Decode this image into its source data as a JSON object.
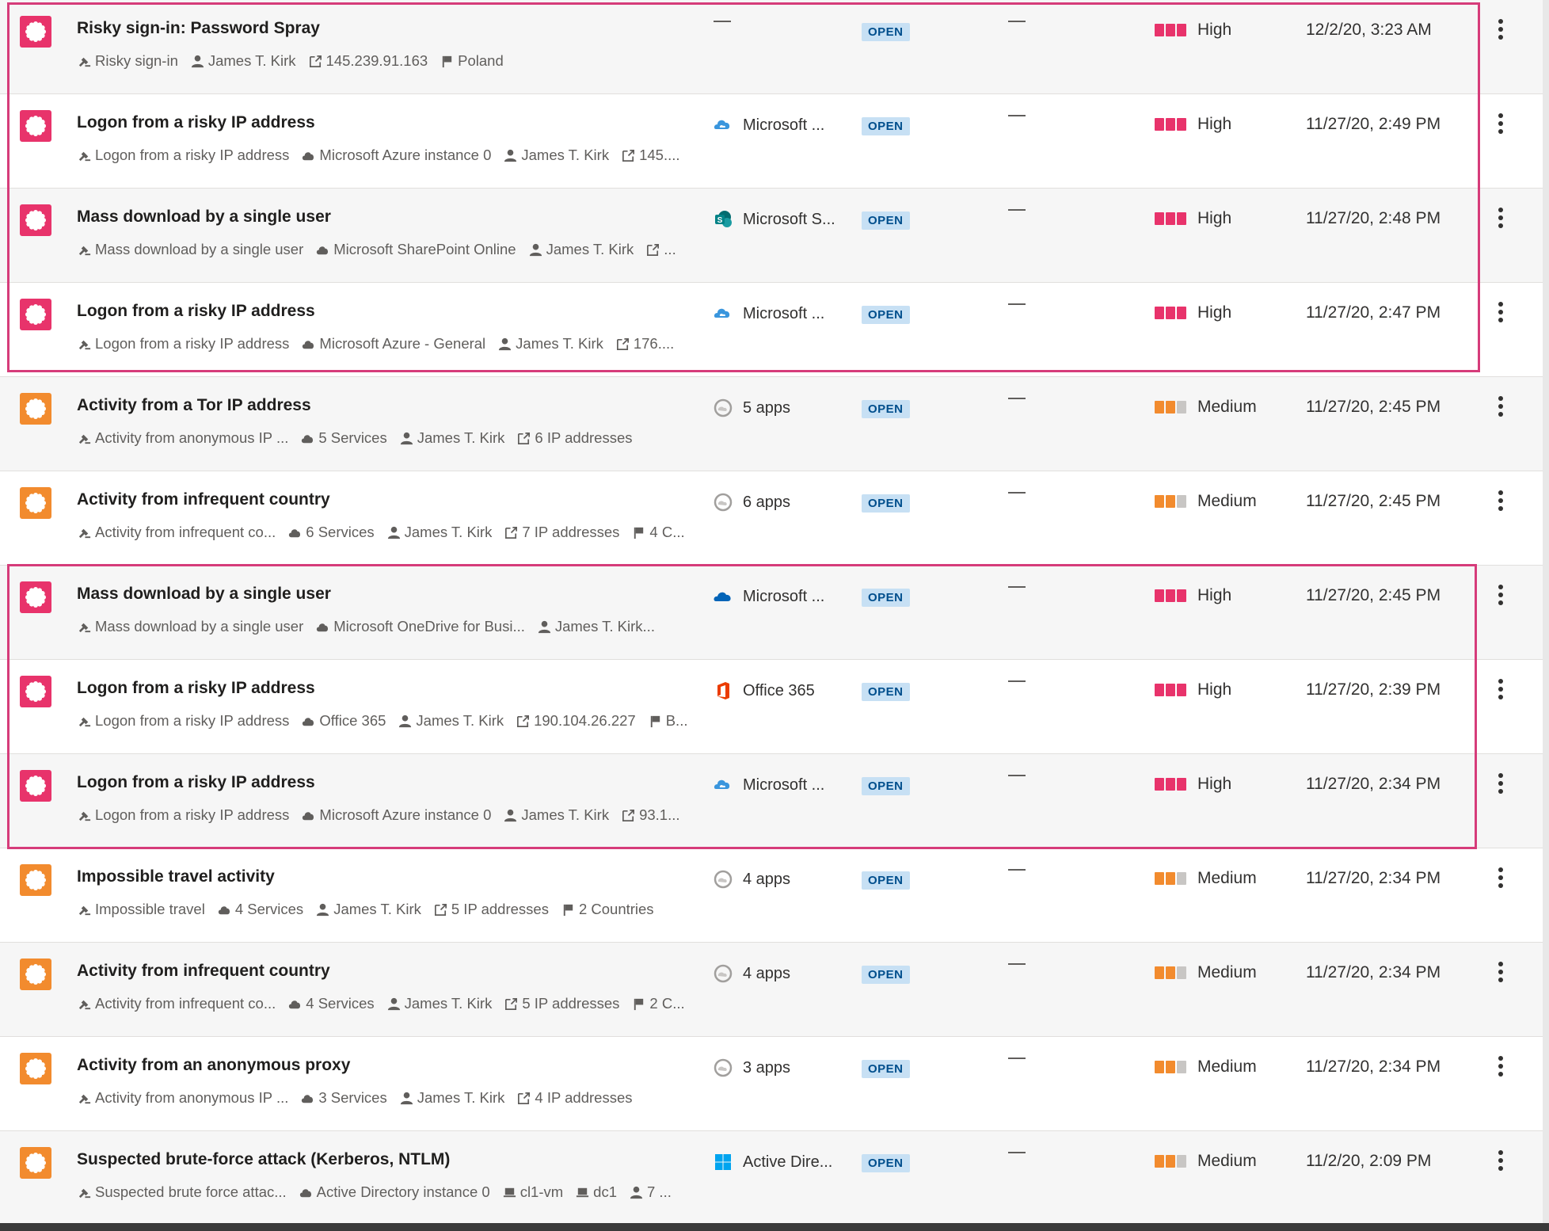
{
  "colors": {
    "high": "#e8336b",
    "medium": "#f28b2e",
    "open_badge_bg": "#c7e0f4",
    "highlight_border": "#d63c7a"
  },
  "alerts": [
    {
      "title": "Risky sign-in: Password Spray",
      "severity_class": "high",
      "meta": [
        {
          "icon": "policy-icon",
          "text": "Risky sign-in"
        },
        {
          "icon": "user-icon",
          "text": "James T. Kirk"
        },
        {
          "icon": "ip-icon",
          "text": "145.239.91.163"
        },
        {
          "icon": "flag-icon",
          "text": "Poland"
        }
      ],
      "app_icon": "none",
      "app": "",
      "status": "OPEN",
      "assigned": "—",
      "severity": "High",
      "time": "12/2/20, 3:23 AM"
    },
    {
      "title": "Logon from a risky IP address",
      "severity_class": "high",
      "meta": [
        {
          "icon": "policy-icon",
          "text": "Logon from a risky IP address"
        },
        {
          "icon": "cloud-icon",
          "text": "Microsoft Azure instance 0"
        },
        {
          "icon": "user-icon",
          "text": "James T. Kirk"
        },
        {
          "icon": "ip-icon",
          "text": "145...."
        }
      ],
      "app_icon": "azure-icon",
      "app": "Microsoft ...",
      "status": "OPEN",
      "assigned": "—",
      "severity": "High",
      "time": "11/27/20, 2:49 PM"
    },
    {
      "title": "Mass download by a single user",
      "severity_class": "high",
      "meta": [
        {
          "icon": "policy-icon",
          "text": "Mass download by a single user"
        },
        {
          "icon": "cloud-icon",
          "text": "Microsoft SharePoint Online"
        },
        {
          "icon": "user-icon",
          "text": "James T. Kirk"
        },
        {
          "icon": "ip-icon",
          "text": "..."
        }
      ],
      "app_icon": "sharepoint-icon",
      "app": "Microsoft S...",
      "status": "OPEN",
      "assigned": "—",
      "severity": "High",
      "time": "11/27/20, 2:48 PM"
    },
    {
      "title": "Logon from a risky IP address",
      "severity_class": "high",
      "meta": [
        {
          "icon": "policy-icon",
          "text": "Logon from a risky IP address"
        },
        {
          "icon": "cloud-icon",
          "text": "Microsoft Azure - General"
        },
        {
          "icon": "user-icon",
          "text": "James T. Kirk"
        },
        {
          "icon": "ip-icon",
          "text": "176...."
        }
      ],
      "app_icon": "azure-icon",
      "app": "Microsoft ...",
      "status": "OPEN",
      "assigned": "—",
      "severity": "High",
      "time": "11/27/20, 2:47 PM"
    },
    {
      "title": "Activity from a Tor IP address",
      "severity_class": "medium",
      "meta": [
        {
          "icon": "policy-icon",
          "text": "Activity from anonymous IP ..."
        },
        {
          "icon": "cloud-icon",
          "text": "5 Services"
        },
        {
          "icon": "user-icon",
          "text": "James T. Kirk"
        },
        {
          "icon": "ip-icon",
          "text": "6 IP addresses"
        }
      ],
      "app_icon": "apps-icon",
      "app": "5 apps",
      "status": "OPEN",
      "assigned": "—",
      "severity": "Medium",
      "time": "11/27/20, 2:45 PM"
    },
    {
      "title": "Activity from infrequent country",
      "severity_class": "medium",
      "meta": [
        {
          "icon": "policy-icon",
          "text": "Activity from infrequent co..."
        },
        {
          "icon": "cloud-icon",
          "text": "6 Services"
        },
        {
          "icon": "user-icon",
          "text": "James T. Kirk"
        },
        {
          "icon": "ip-icon",
          "text": "7 IP addresses"
        },
        {
          "icon": "flag-icon",
          "text": "4 C..."
        }
      ],
      "app_icon": "apps-icon",
      "app": "6 apps",
      "status": "OPEN",
      "assigned": "—",
      "severity": "Medium",
      "time": "11/27/20, 2:45 PM"
    },
    {
      "title": "Mass download by a single user",
      "severity_class": "high",
      "meta": [
        {
          "icon": "policy-icon",
          "text": "Mass download by a single user"
        },
        {
          "icon": "cloud-icon",
          "text": "Microsoft OneDrive for Busi..."
        },
        {
          "icon": "user-icon",
          "text": "James T. Kirk..."
        }
      ],
      "app_icon": "onedrive-icon",
      "app": "Microsoft ...",
      "status": "OPEN",
      "assigned": "—",
      "severity": "High",
      "time": "11/27/20, 2:45 PM"
    },
    {
      "title": "Logon from a risky IP address",
      "severity_class": "high",
      "meta": [
        {
          "icon": "policy-icon",
          "text": "Logon from a risky IP address"
        },
        {
          "icon": "cloud-icon",
          "text": "Office 365"
        },
        {
          "icon": "user-icon",
          "text": "James T. Kirk"
        },
        {
          "icon": "ip-icon",
          "text": "190.104.26.227"
        },
        {
          "icon": "flag-icon",
          "text": "B..."
        }
      ],
      "app_icon": "office365-icon",
      "app": "Office 365",
      "status": "OPEN",
      "assigned": "—",
      "severity": "High",
      "time": "11/27/20, 2:39 PM"
    },
    {
      "title": "Logon from a risky IP address",
      "severity_class": "high",
      "meta": [
        {
          "icon": "policy-icon",
          "text": "Logon from a risky IP address"
        },
        {
          "icon": "cloud-icon",
          "text": "Microsoft Azure instance 0"
        },
        {
          "icon": "user-icon",
          "text": "James T. Kirk"
        },
        {
          "icon": "ip-icon",
          "text": "93.1..."
        }
      ],
      "app_icon": "azure-icon",
      "app": "Microsoft ...",
      "status": "OPEN",
      "assigned": "—",
      "severity": "High",
      "time": "11/27/20, 2:34 PM"
    },
    {
      "title": "Impossible travel activity",
      "severity_class": "medium",
      "meta": [
        {
          "icon": "policy-icon",
          "text": "Impossible travel"
        },
        {
          "icon": "cloud-icon",
          "text": "4 Services"
        },
        {
          "icon": "user-icon",
          "text": "James T. Kirk"
        },
        {
          "icon": "ip-icon",
          "text": "5 IP addresses"
        },
        {
          "icon": "flag-icon",
          "text": "2 Countries"
        }
      ],
      "app_icon": "apps-icon",
      "app": "4 apps",
      "status": "OPEN",
      "assigned": "—",
      "severity": "Medium",
      "time": "11/27/20, 2:34 PM"
    },
    {
      "title": "Activity from infrequent country",
      "severity_class": "medium",
      "meta": [
        {
          "icon": "policy-icon",
          "text": "Activity from infrequent co..."
        },
        {
          "icon": "cloud-icon",
          "text": "4 Services"
        },
        {
          "icon": "user-icon",
          "text": "James T. Kirk"
        },
        {
          "icon": "ip-icon",
          "text": "5 IP addresses"
        },
        {
          "icon": "flag-icon",
          "text": "2 C..."
        }
      ],
      "app_icon": "apps-icon",
      "app": "4 apps",
      "status": "OPEN",
      "assigned": "—",
      "severity": "Medium",
      "time": "11/27/20, 2:34 PM"
    },
    {
      "title": "Activity from an anonymous proxy",
      "severity_class": "medium",
      "meta": [
        {
          "icon": "policy-icon",
          "text": "Activity from anonymous IP ..."
        },
        {
          "icon": "cloud-icon",
          "text": "3 Services"
        },
        {
          "icon": "user-icon",
          "text": "James T. Kirk"
        },
        {
          "icon": "ip-icon",
          "text": "4 IP addresses"
        }
      ],
      "app_icon": "apps-icon",
      "app": "3 apps",
      "status": "OPEN",
      "assigned": "—",
      "severity": "Medium",
      "time": "11/27/20, 2:34 PM"
    },
    {
      "title": "Suspected brute-force attack (Kerberos, NTLM)",
      "severity_class": "medium",
      "meta": [
        {
          "icon": "policy-icon",
          "text": "Suspected brute force attac..."
        },
        {
          "icon": "cloud-icon",
          "text": "Active Directory instance 0"
        },
        {
          "icon": "device-icon",
          "text": "cl1-vm"
        },
        {
          "icon": "device-icon",
          "text": "dc1"
        },
        {
          "icon": "user-icon",
          "text": "7 ..."
        }
      ],
      "app_icon": "windows-icon",
      "app": "Active Dire...",
      "status": "OPEN",
      "assigned": "—",
      "severity": "Medium",
      "time": "11/2/20, 2:09 PM"
    }
  ]
}
